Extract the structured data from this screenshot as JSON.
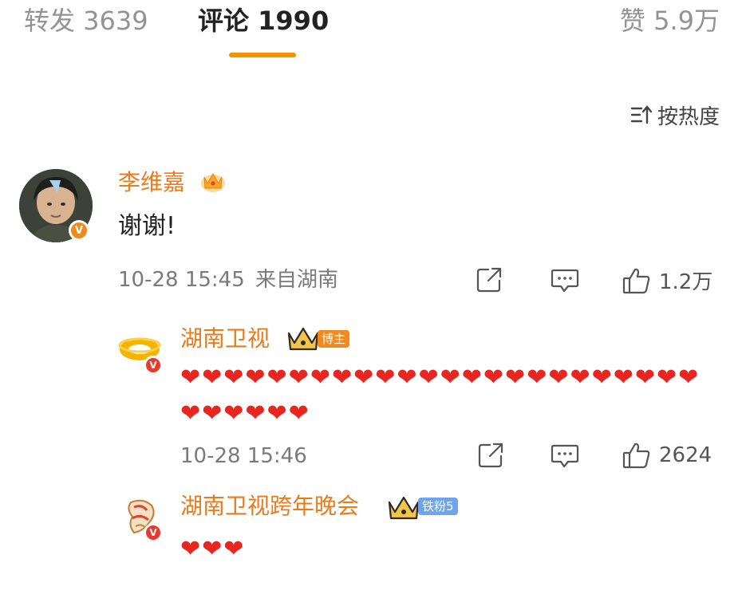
{
  "tabs": {
    "repost": "转发 3639",
    "comments": "评论 1990",
    "likes": "赞 5.9万"
  },
  "sort": {
    "label": "按热度",
    "icon": "sort-icon"
  },
  "comments": [
    {
      "name": "李维嘉",
      "text": "谢谢!",
      "time": "10-28 15:45",
      "location": "来自湖南",
      "like_count": "1.2万"
    },
    {
      "name": "湖南卫视",
      "badge": "博主",
      "hearts": "❤❤❤❤❤❤❤❤❤❤❤❤❤❤❤❤❤❤❤❤❤❤❤❤❤❤❤❤❤❤",
      "time": "10-28 15:46",
      "like_count": "2624"
    },
    {
      "name": "湖南卫视跨年晚会",
      "badge": "铁粉5",
      "hearts": "❤❤❤"
    }
  ],
  "colors": {
    "accent": "#f59300",
    "name": "#ea7b1a",
    "heart": "#e8261f",
    "meta": "#7a7a7a"
  }
}
